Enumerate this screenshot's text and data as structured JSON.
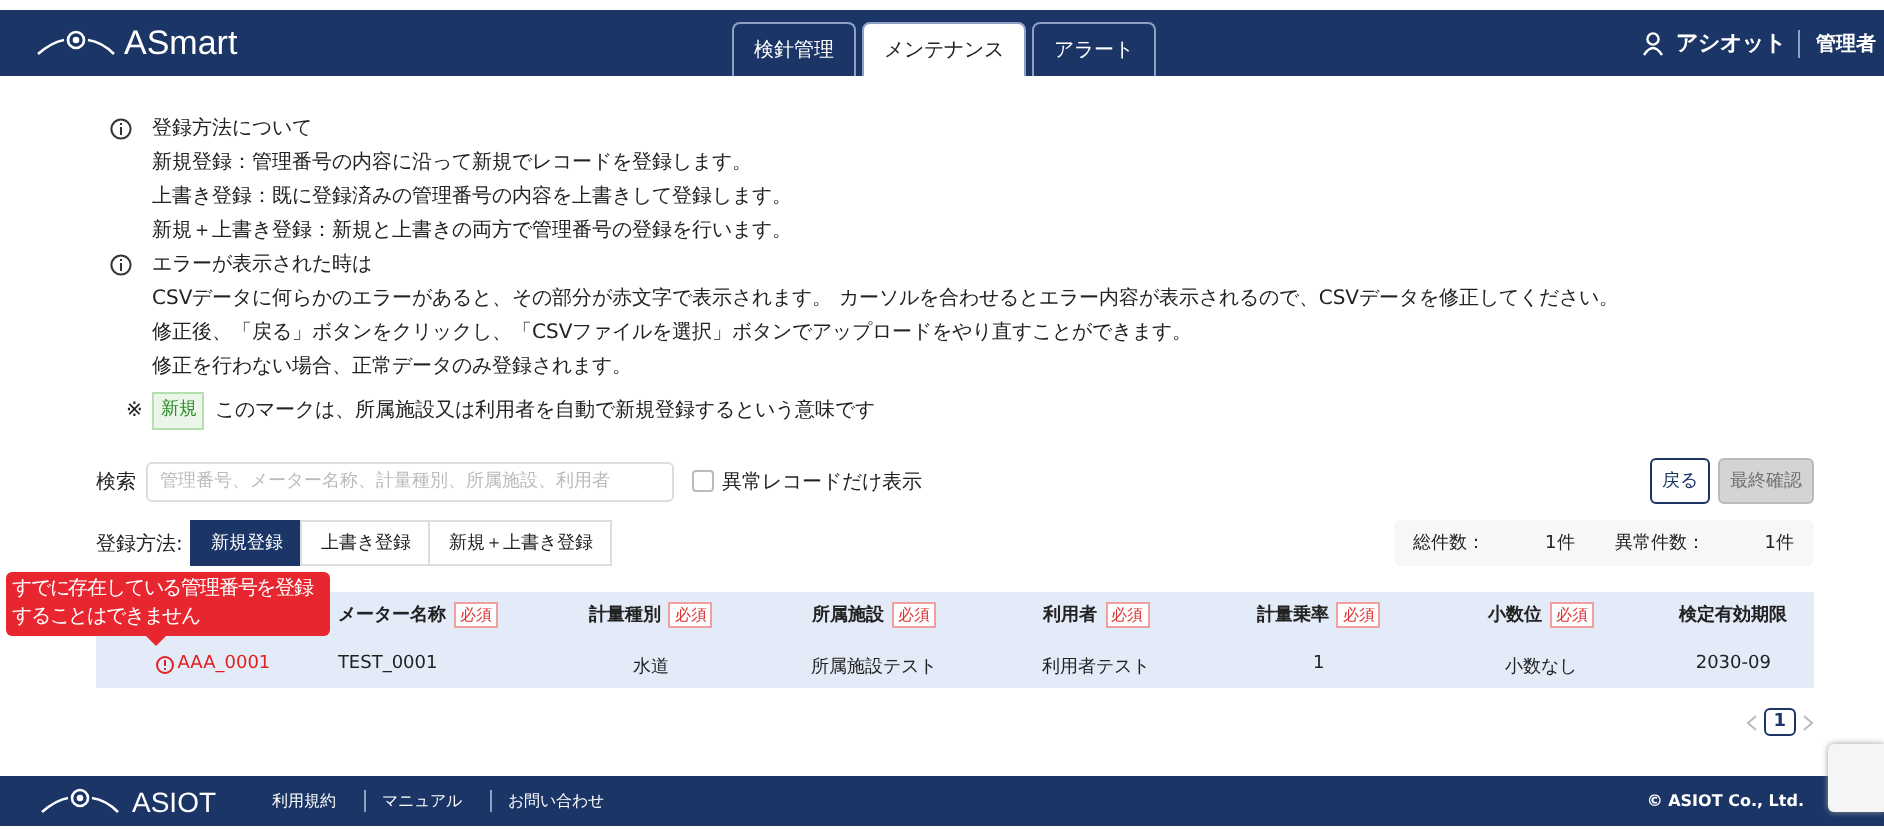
{
  "header": {
    "logo_text": "ASmart",
    "tabs": [
      {
        "label": "検針管理",
        "selected": false
      },
      {
        "label": "メンテナンス",
        "selected": true
      },
      {
        "label": "アラート",
        "selected": false
      }
    ],
    "user": "アシオット",
    "role": "管理者"
  },
  "info": {
    "sections": [
      {
        "title": "登録方法について",
        "lines": [
          "新規登録：管理番号の内容に沿って新規でレコードを登録します。",
          "上書き登録：既に登録済みの管理番号の内容を上書きして登録します。",
          "新規＋上書き登録：新規と上書きの両方で管理番号の登録を行います。"
        ]
      },
      {
        "title": "エラーが表示された時は",
        "lines": [
          "CSVデータに何らかのエラーがあると、その部分が赤文字で表示されます。 カーソルを合わせるとエラー内容が表示されるので、CSVデータを修正してください。",
          "修正後、「戻る」ボタンをクリックし、「CSVファイルを選択」ボタンでアップロードをやり直すことができます。",
          "修正を行わない場合、正常データのみ登録されます。"
        ]
      }
    ],
    "note_mark": "※",
    "note_badge": "新規",
    "note_text": "このマークは、所属施設又は利用者を自動で新規登録するという意味です"
  },
  "search": {
    "label": "検索",
    "placeholder": "管理番号、メーター名称、計量種別、所属施設、利用者",
    "abnormal_only": {
      "label": "異常レコードだけ表示",
      "checked": false
    }
  },
  "actions": [
    {
      "label": "戻る",
      "disabled": false
    },
    {
      "label": "最終確認",
      "disabled": true
    }
  ],
  "registration": {
    "label": "登録方法:",
    "options": [
      {
        "label": "新規登録",
        "selected": true
      },
      {
        "label": "上書き登録",
        "selected": false
      },
      {
        "label": "新規＋上書き登録",
        "selected": false
      }
    ]
  },
  "summary": [
    {
      "label": "総件数：",
      "value": "1件"
    },
    {
      "label": "異常件数：",
      "value": "1件"
    }
  ],
  "tooltip": "すでに存在している管理番号を登録することはできません",
  "table": {
    "columns": [
      {},
      {
        "label": "メーター名称",
        "badge": "必須"
      },
      {
        "label": "計量種別",
        "badge": "必須"
      },
      {
        "label": "所属施設",
        "badge": "必須"
      },
      {
        "label": "利用者",
        "badge": "必須"
      },
      {
        "label": "計量乗率",
        "badge": "必須"
      },
      {
        "label": "小数位",
        "badge": "必須"
      },
      {
        "label": "検定有効期限"
      }
    ],
    "rows": [
      {
        "cells": [
          {
            "text": "AAA_0001",
            "error": true
          },
          {
            "text": "TEST_0001",
            "error": false
          },
          {
            "text": "水道",
            "error": false
          },
          {
            "text": "所属施設テスト",
            "error": false
          },
          {
            "text": "利用者テスト",
            "error": false
          },
          {
            "text": "1",
            "error": false
          },
          {
            "text": "小数なし",
            "error": false
          },
          {
            "text": "2030-09",
            "error": false
          }
        ]
      }
    ]
  },
  "pagination": {
    "pages": [
      {
        "label": "1",
        "selected": true
      }
    ]
  },
  "footer": {
    "logo_text": "ASIOT",
    "links": [
      "利用規約",
      "マニュアル",
      "お問い合わせ"
    ],
    "copyright": "© ASIOT Co., Ltd."
  }
}
